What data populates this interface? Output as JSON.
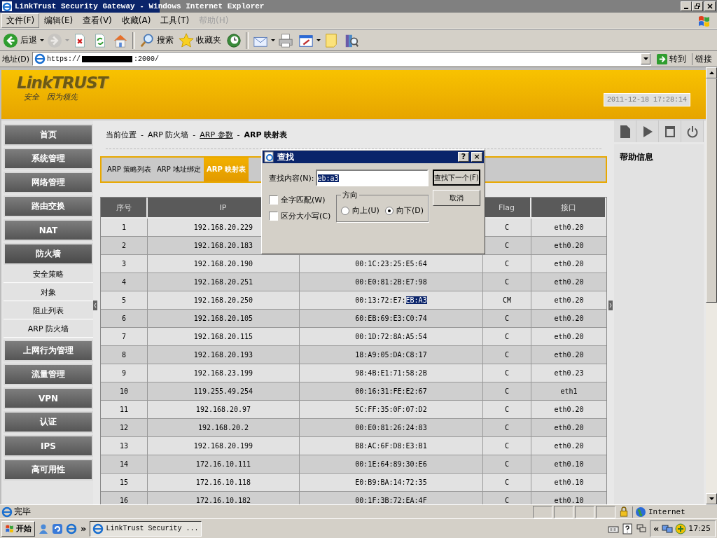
{
  "window": {
    "title": "LinkTrust Security Gateway - Windows Internet Explorer"
  },
  "menu": [
    {
      "label": "文件(F)",
      "selected": true,
      "disabled": false
    },
    {
      "label": "编辑(E)",
      "selected": false,
      "disabled": false
    },
    {
      "label": "查看(V)",
      "selected": false,
      "disabled": false
    },
    {
      "label": "收藏(A)",
      "selected": false,
      "disabled": false
    },
    {
      "label": "工具(T)",
      "selected": false,
      "disabled": false
    },
    {
      "label": "帮助(H)",
      "selected": false,
      "disabled": true
    }
  ],
  "toolbar": [
    [
      {
        "kind": "back",
        "label": "后退",
        "dropdown": true,
        "disabled": false
      },
      {
        "kind": "forward",
        "dropdown": true,
        "disabled": true
      },
      {
        "kind": "stop",
        "dropdown": false,
        "disabled": false
      },
      {
        "kind": "refresh",
        "dropdown": false,
        "disabled": false
      },
      {
        "kind": "home",
        "dropdown": false,
        "disabled": false
      }
    ],
    [
      {
        "kind": "search",
        "label": "搜索",
        "dropdown": false,
        "disabled": false
      },
      {
        "kind": "favorites",
        "label": "收藏夹",
        "dropdown": false,
        "disabled": false
      },
      {
        "kind": "media",
        "dropdown": false,
        "disabled": false
      }
    ],
    [
      {
        "kind": "mail",
        "dropdown": true,
        "disabled": false
      },
      {
        "kind": "print",
        "dropdown": false,
        "disabled": false
      },
      {
        "kind": "edit",
        "dropdown": true,
        "disabled": false
      },
      {
        "kind": "note",
        "dropdown": false,
        "disabled": false
      },
      {
        "kind": "research",
        "dropdown": false,
        "disabled": false
      }
    ]
  ],
  "address": {
    "label": "地址(D)",
    "prefix": "https://",
    "suffix": ":2000/",
    "go": "转到",
    "links": "链接"
  },
  "header": {
    "logo": "LinkTRUST",
    "slogan": "安全　因为领先",
    "datetime": "2011-12-18 17:28:14"
  },
  "sidebar": [
    {
      "label": "首页",
      "expanded": false
    },
    {
      "label": "系统管理",
      "expanded": false
    },
    {
      "label": "网络管理",
      "expanded": false
    },
    {
      "label": "路由交换",
      "expanded": false
    },
    {
      "label": "NAT",
      "expanded": false
    },
    {
      "label": "防火墙",
      "expanded": true,
      "children": [
        {
          "label": "安全策略"
        },
        {
          "label": "对象"
        },
        {
          "label": "阻止列表"
        },
        {
          "label": "ARP 防火墙"
        }
      ]
    },
    {
      "label": "上网行为管理",
      "expanded": false
    },
    {
      "label": "流量管理",
      "expanded": false
    },
    {
      "label": "VPN",
      "expanded": false
    },
    {
      "label": "认证",
      "expanded": false
    },
    {
      "label": "IPS",
      "expanded": false
    },
    {
      "label": "高可用性",
      "expanded": false
    }
  ],
  "breadcrumb": [
    {
      "kind": "text",
      "label": "当前位置"
    },
    {
      "kind": "sep",
      "label": "-"
    },
    {
      "kind": "text",
      "label": "ARP 防火墙"
    },
    {
      "kind": "sep",
      "label": "-"
    },
    {
      "kind": "link",
      "label": "ARP 参数"
    },
    {
      "kind": "sep",
      "label": "-"
    },
    {
      "kind": "current",
      "label": "ARP 映射表"
    }
  ],
  "tabs": [
    {
      "label": "ARP 策略列表",
      "selected": false
    },
    {
      "label": "ARP 地址绑定",
      "selected": false
    },
    {
      "label": "ARP 映射表",
      "selected": true
    }
  ],
  "table": {
    "columns": [
      {
        "label": "序号"
      },
      {
        "label": "IP"
      },
      {},
      {
        "label": "Flag"
      },
      {
        "label": "接口"
      }
    ],
    "rows": [
      {
        "no": "1",
        "ip": "192.168.20.229",
        "flag": "C",
        "iface": "eth0.20"
      },
      {
        "no": "2",
        "ip": "192.168.20.183",
        "flag": "C",
        "iface": "eth0.20"
      },
      {
        "no": "3",
        "ip": "192.168.20.190",
        "column_3": "00:1C:23:25:E5:64",
        "flag": "C",
        "iface": "eth0.20"
      },
      {
        "no": "4",
        "ip": "192.168.20.251",
        "column_3": "00:E0:81:2B:E7:98",
        "flag": "C",
        "iface": "eth0.20"
      },
      {
        "no": "5",
        "ip": "192.168.20.250",
        "column_3": "00:13:72:E7:",
        "column_3_match": "EB:A3",
        "flag": "CM",
        "iface": "eth0.20"
      },
      {
        "no": "6",
        "ip": "192.168.20.105",
        "column_3": "60:EB:69:E3:C0:74",
        "flag": "C",
        "iface": "eth0.20"
      },
      {
        "no": "7",
        "ip": "192.168.20.115",
        "column_3": "00:1D:72:8A:A5:54",
        "flag": "C",
        "iface": "eth0.20"
      },
      {
        "no": "8",
        "ip": "192.168.20.193",
        "column_3": "18:A9:05:DA:C8:17",
        "flag": "C",
        "iface": "eth0.20"
      },
      {
        "no": "9",
        "ip": "192.168.23.199",
        "column_3": "98:4B:E1:71:58:2B",
        "flag": "C",
        "iface": "eth0.23"
      },
      {
        "no": "10",
        "ip": "119.255.49.254",
        "column_3": "00:16:31:FE:E2:67",
        "flag": "C",
        "iface": "eth1"
      },
      {
        "no": "11",
        "ip": "192.168.20.97",
        "column_3": "5C:FF:35:0F:07:D2",
        "flag": "C",
        "iface": "eth0.20"
      },
      {
        "no": "12",
        "ip": "192.168.20.2",
        "column_3": "00:E0:81:26:24:83",
        "flag": "C",
        "iface": "eth0.20"
      },
      {
        "no": "13",
        "ip": "192.168.20.199",
        "column_3": "B8:AC:6F:D8:E3:B1",
        "flag": "C",
        "iface": "eth0.20"
      },
      {
        "no": "14",
        "ip": "172.16.10.111",
        "column_3": "00:1E:64:89:30:E6",
        "flag": "C",
        "iface": "eth0.10"
      },
      {
        "no": "15",
        "ip": "172.16.10.118",
        "column_3": "E0:B9:BA:14:72:35",
        "flag": "C",
        "iface": "eth0.10"
      },
      {
        "no": "16",
        "ip": "172.16.10.182",
        "column_3": "00:1F:3B:72:EA:4F",
        "flag": "C",
        "iface": "eth0.10"
      }
    ]
  },
  "right_panel": {
    "tools": [
      {
        "kind": "document"
      },
      {
        "kind": "play"
      },
      {
        "kind": "window"
      },
      {
        "kind": "power"
      }
    ],
    "help_title": "帮助信息"
  },
  "find_dialog": {
    "title": "查找",
    "help": "?",
    "close": "×",
    "find_label": "查找内容(N):",
    "find_value": "eb:a3",
    "options": [
      {
        "label": "全字匹配(W)",
        "checked": false
      },
      {
        "label": "区分大小写(C)",
        "checked": false
      }
    ],
    "direction": {
      "legend": "方向",
      "choices": [
        {
          "label": "向上(U)",
          "selected": false
        },
        {
          "label": "向下(D)",
          "selected": true
        }
      ]
    },
    "buttons": [
      {
        "label": "查找下一个(F)",
        "default": true
      },
      {
        "label": "取消",
        "default": false
      }
    ]
  },
  "status_bar": {
    "text": "完毕",
    "zone": "Internet"
  },
  "taskbar": {
    "start": "开始",
    "more": "»",
    "tasks": [
      {
        "label": "LinkTrust Security ...",
        "selected": true
      }
    ],
    "tray_more": "«",
    "clock": "17:25"
  }
}
